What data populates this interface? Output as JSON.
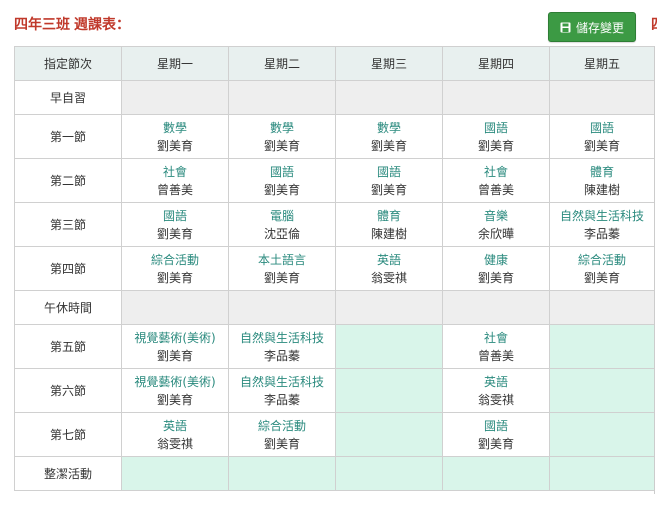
{
  "header": {
    "class_name": "四年三班",
    "table_label": "週課表：",
    "save_label": "儲存變更",
    "edge_text": "四"
  },
  "colors": {
    "accent_red": "#c0392b",
    "save_green": "#3c9a44",
    "subject_teal": "#2a8a7e",
    "gray_cell": "#eeeeee",
    "mint_cell": "#d9f5ea",
    "header_bg": "#e8f0ef"
  },
  "timetable": {
    "columns": [
      "指定節次",
      "星期一",
      "星期二",
      "星期三",
      "星期四",
      "星期五"
    ],
    "rows": [
      {
        "period": "早自習",
        "cells": [
          {
            "bg": "gray",
            "subject": "",
            "teacher": ""
          },
          {
            "bg": "gray",
            "subject": "",
            "teacher": ""
          },
          {
            "bg": "gray",
            "subject": "",
            "teacher": ""
          },
          {
            "bg": "gray",
            "subject": "",
            "teacher": ""
          },
          {
            "bg": "gray",
            "subject": "",
            "teacher": ""
          }
        ]
      },
      {
        "period": "第一節",
        "cells": [
          {
            "bg": "white",
            "subject": "數學",
            "teacher": "劉美育"
          },
          {
            "bg": "white",
            "subject": "數學",
            "teacher": "劉美育"
          },
          {
            "bg": "white",
            "subject": "數學",
            "teacher": "劉美育"
          },
          {
            "bg": "white",
            "subject": "國語",
            "teacher": "劉美育"
          },
          {
            "bg": "white",
            "subject": "國語",
            "teacher": "劉美育"
          }
        ]
      },
      {
        "period": "第二節",
        "cells": [
          {
            "bg": "white",
            "subject": "社會",
            "teacher": "曾善美"
          },
          {
            "bg": "white",
            "subject": "國語",
            "teacher": "劉美育"
          },
          {
            "bg": "white",
            "subject": "國語",
            "teacher": "劉美育"
          },
          {
            "bg": "white",
            "subject": "社會",
            "teacher": "曾善美"
          },
          {
            "bg": "white",
            "subject": "體育",
            "teacher": "陳建樹"
          }
        ]
      },
      {
        "period": "第三節",
        "cells": [
          {
            "bg": "white",
            "subject": "國語",
            "teacher": "劉美育"
          },
          {
            "bg": "white",
            "subject": "電腦",
            "teacher": "沈亞倫"
          },
          {
            "bg": "white",
            "subject": "體育",
            "teacher": "陳建樹"
          },
          {
            "bg": "white",
            "subject": "音樂",
            "teacher": "余欣曄"
          },
          {
            "bg": "white",
            "subject": "自然與生活科技",
            "teacher": "李品蓁"
          }
        ]
      },
      {
        "period": "第四節",
        "cells": [
          {
            "bg": "white",
            "subject": "綜合活動",
            "teacher": "劉美育"
          },
          {
            "bg": "white",
            "subject": "本土語言",
            "teacher": "劉美育"
          },
          {
            "bg": "white",
            "subject": "英語",
            "teacher": "翁雯祺"
          },
          {
            "bg": "white",
            "subject": "健康",
            "teacher": "劉美育"
          },
          {
            "bg": "white",
            "subject": "綜合活動",
            "teacher": "劉美育"
          }
        ]
      },
      {
        "period": "午休時間",
        "cells": [
          {
            "bg": "gray",
            "subject": "",
            "teacher": ""
          },
          {
            "bg": "gray",
            "subject": "",
            "teacher": ""
          },
          {
            "bg": "gray",
            "subject": "",
            "teacher": ""
          },
          {
            "bg": "gray",
            "subject": "",
            "teacher": ""
          },
          {
            "bg": "gray",
            "subject": "",
            "teacher": ""
          }
        ]
      },
      {
        "period": "第五節",
        "cells": [
          {
            "bg": "white",
            "subject": "視覺藝術(美術)",
            "teacher": "劉美育"
          },
          {
            "bg": "white",
            "subject": "自然與生活科技",
            "teacher": "李品蓁"
          },
          {
            "bg": "mint",
            "subject": "",
            "teacher": ""
          },
          {
            "bg": "white",
            "subject": "社會",
            "teacher": "曾善美"
          },
          {
            "bg": "mint",
            "subject": "",
            "teacher": ""
          }
        ]
      },
      {
        "period": "第六節",
        "cells": [
          {
            "bg": "white",
            "subject": "視覺藝術(美術)",
            "teacher": "劉美育"
          },
          {
            "bg": "white",
            "subject": "自然與生活科技",
            "teacher": "李品蓁"
          },
          {
            "bg": "mint",
            "subject": "",
            "teacher": ""
          },
          {
            "bg": "white",
            "subject": "英語",
            "teacher": "翁雯祺"
          },
          {
            "bg": "mint",
            "subject": "",
            "teacher": ""
          }
        ]
      },
      {
        "period": "第七節",
        "cells": [
          {
            "bg": "white",
            "subject": "英語",
            "teacher": "翁雯祺"
          },
          {
            "bg": "white",
            "subject": "綜合活動",
            "teacher": "劉美育"
          },
          {
            "bg": "mint",
            "subject": "",
            "teacher": ""
          },
          {
            "bg": "white",
            "subject": "國語",
            "teacher": "劉美育"
          },
          {
            "bg": "mint",
            "subject": "",
            "teacher": ""
          }
        ]
      },
      {
        "period": "整潔活動",
        "cells": [
          {
            "bg": "mint",
            "subject": "",
            "teacher": ""
          },
          {
            "bg": "mint",
            "subject": "",
            "teacher": ""
          },
          {
            "bg": "mint",
            "subject": "",
            "teacher": ""
          },
          {
            "bg": "mint",
            "subject": "",
            "teacher": ""
          },
          {
            "bg": "mint",
            "subject": "",
            "teacher": ""
          }
        ]
      }
    ]
  }
}
